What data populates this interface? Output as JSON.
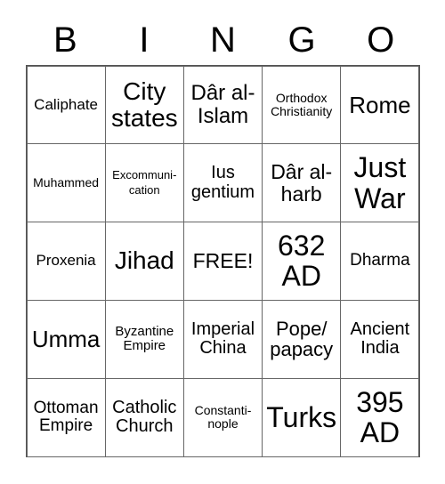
{
  "header": [
    "B",
    "I",
    "N",
    "G",
    "O"
  ],
  "cells": [
    [
      "Caliphate",
      "City\nstates",
      "Dâr al-\nIslam",
      "Orthodox\nChristianity",
      "Rome"
    ],
    [
      "Muhammed",
      "Excommuni-\ncation",
      "Ius\ngentium",
      "Dâr al-\nharb",
      "Just\nWar"
    ],
    [
      "Proxenia",
      "Jihad",
      "FREE!",
      "632\nAD",
      "Dharma"
    ],
    [
      "Umma",
      "Byzantine\nEmpire",
      "Imperial\nChina",
      "Pope/\npapacy",
      "Ancient\nIndia"
    ],
    [
      "Ottoman\nEmpire",
      "Catholic\nChurch",
      "Constanti-\nnople",
      "Turks",
      "395\nAD"
    ]
  ]
}
